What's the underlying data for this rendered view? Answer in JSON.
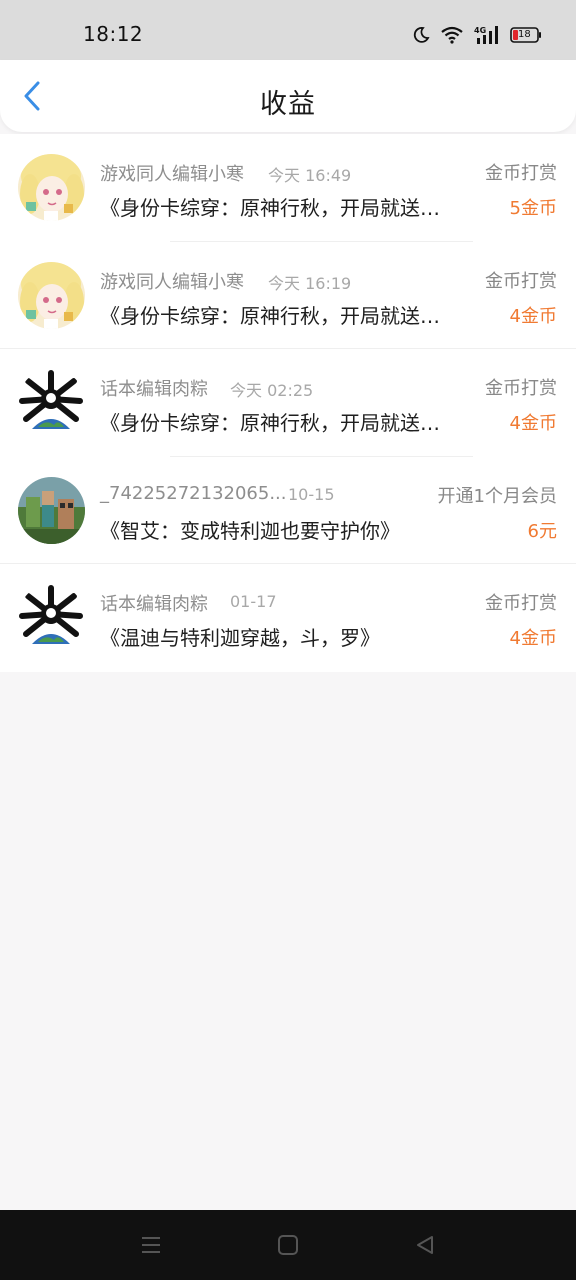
{
  "status_bar": {
    "time": "18:12",
    "battery_level": "18",
    "icons": [
      "moon-icon",
      "wifi-icon",
      "signal-4g-icon",
      "battery-icon"
    ]
  },
  "header": {
    "title": "收益",
    "back_icon": "chevron-left-icon"
  },
  "colors": {
    "accent": "#3a8ee6",
    "amount": "#f07a32",
    "muted_text": "#8e8e8e"
  },
  "items": [
    {
      "user": "游戏同人编辑小寒",
      "time": "今天 16:49",
      "type": "金币打赏",
      "book": "《身份卡综穿：原神行秋，开局就送…",
      "amount": "5金币"
    },
    {
      "user": "游戏同人编辑小寒",
      "time": "今天 16:19",
      "type": "金币打赏",
      "book": "《身份卡综穿：原神行秋，开局就送…",
      "amount": "4金币"
    },
    {
      "user": "话本编辑肉粽",
      "time": "今天 02:25",
      "type": "金币打赏",
      "book": "《身份卡综穿：原神行秋，开局就送…",
      "amount": "4金币"
    },
    {
      "user": "_74225272132065...",
      "time": "10-15",
      "type": "开通1个月会员",
      "book": "《智艾：变成特利迦也要守护你》",
      "amount": "6元"
    },
    {
      "user": "话本编辑肉粽",
      "time": "01-17",
      "type": "金币打赏",
      "book": "《温迪与特利迦穿越，斗，罗》",
      "amount": "4金币"
    }
  ],
  "nav_bar": {
    "icons": [
      "menu-icon",
      "home-square-icon",
      "back-triangle-icon"
    ]
  }
}
